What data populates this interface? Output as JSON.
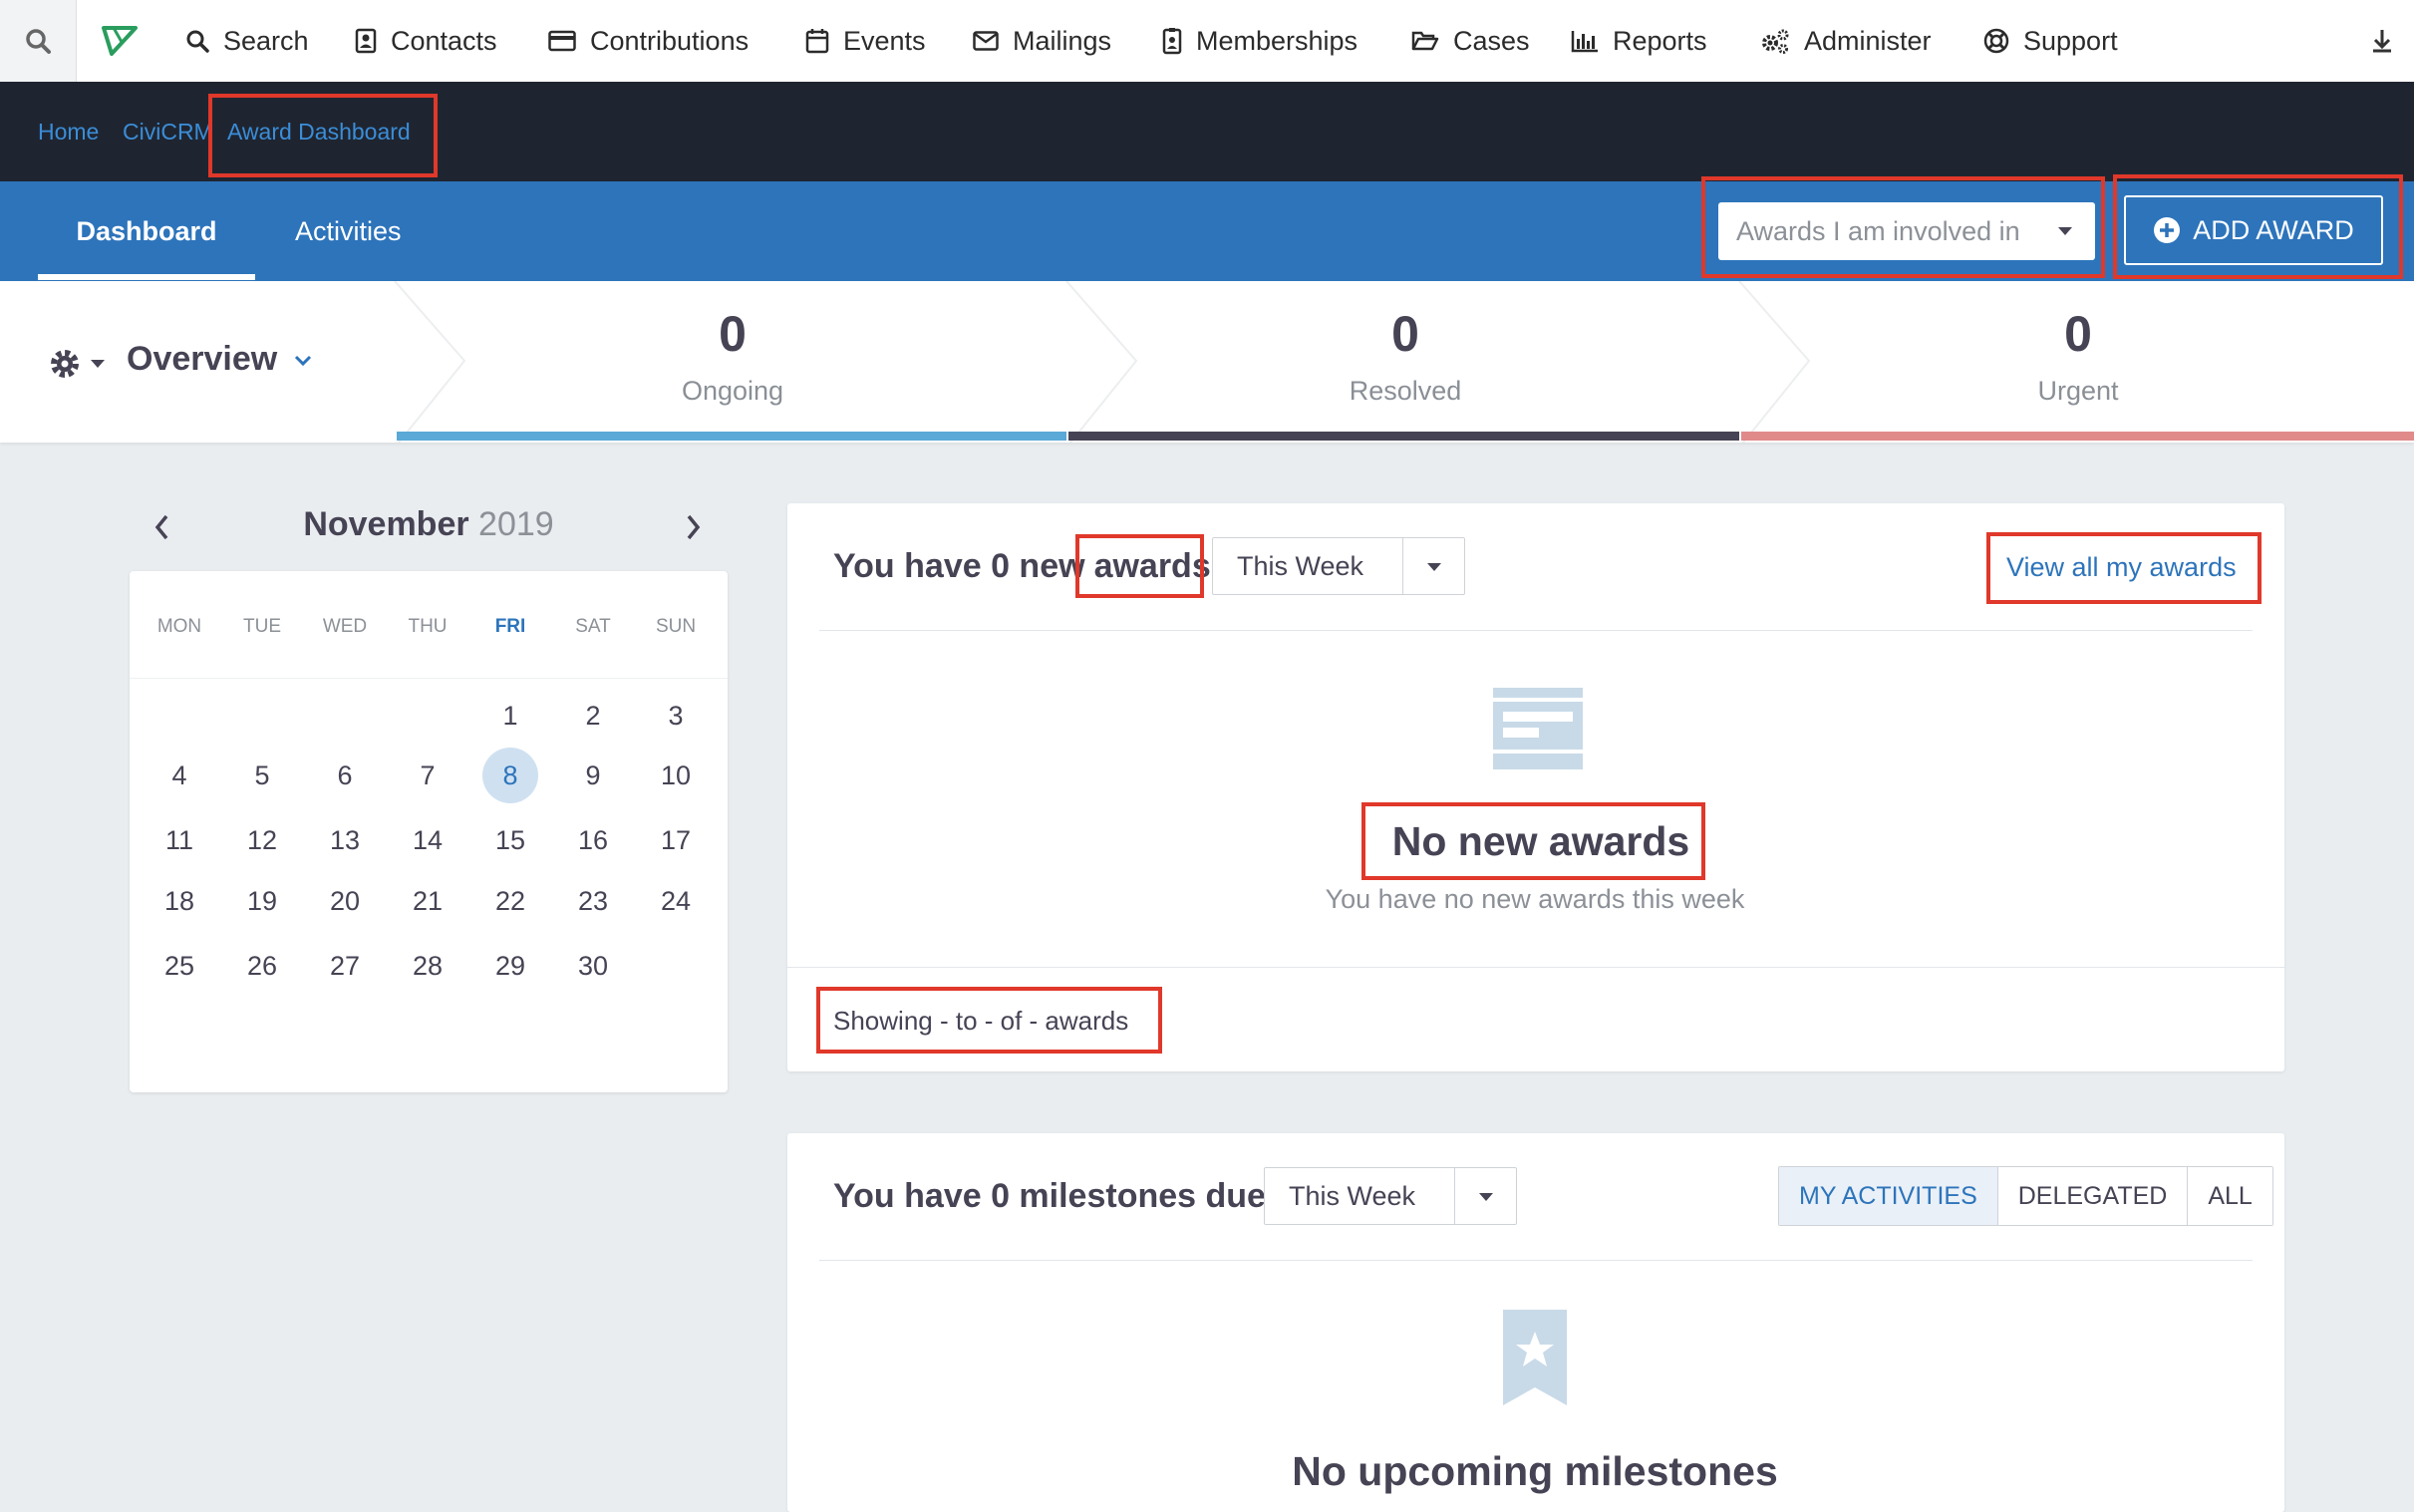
{
  "menu": {
    "items": [
      {
        "label": "Search",
        "icon": "magnifier-icon"
      },
      {
        "label": "Contacts",
        "icon": "contact-card-icon"
      },
      {
        "label": "Contributions",
        "icon": "credit-card-icon"
      },
      {
        "label": "Events",
        "icon": "calendar-icon"
      },
      {
        "label": "Mailings",
        "icon": "envelope-icon"
      },
      {
        "label": "Memberships",
        "icon": "id-badge-icon"
      },
      {
        "label": "Cases",
        "icon": "folder-open-icon"
      },
      {
        "label": "Reports",
        "icon": "bar-chart-icon"
      },
      {
        "label": "Administer",
        "icon": "gears-icon"
      },
      {
        "label": "Support",
        "icon": "life-ring-icon"
      }
    ]
  },
  "breadcrumb": [
    "Home",
    "CiviCRM",
    "Award Dashboard"
  ],
  "tabs": {
    "dashboard": "Dashboard",
    "activities": "Activities"
  },
  "awards_filter": {
    "value": "Awards I am involved in"
  },
  "add_award": {
    "label": "ADD AWARD"
  },
  "overview": {
    "title": "Overview",
    "stats": [
      {
        "value": "0",
        "label": "Ongoing",
        "color": "#5aa9d6"
      },
      {
        "value": "0",
        "label": "Resolved",
        "color": "#464354"
      },
      {
        "value": "0",
        "label": "Urgent",
        "color": "#e08a8a"
      }
    ]
  },
  "calendar": {
    "month": "November",
    "year": "2019",
    "weekdays": [
      "MON",
      "TUE",
      "WED",
      "THU",
      "FRI",
      "SAT",
      "SUN"
    ],
    "highlight_weekday": "FRI",
    "weeks": [
      [
        "",
        "",
        "",
        "",
        "1",
        "2",
        "3"
      ],
      [
        "4",
        "5",
        "6",
        "7",
        "8",
        "9",
        "10"
      ],
      [
        "11",
        "12",
        "13",
        "14",
        "15",
        "16",
        "17"
      ],
      [
        "18",
        "19",
        "20",
        "21",
        "22",
        "23",
        "24"
      ],
      [
        "25",
        "26",
        "27",
        "28",
        "29",
        "30",
        ""
      ]
    ],
    "today": "8"
  },
  "awards_panel": {
    "heading_prefix": "You have 0 new",
    "heading_word": "awards",
    "period": "This Week",
    "view_all": "View all my awards",
    "empty_title": "No new awards",
    "empty_subtitle": "You have no new awards this week",
    "pager": "Showing - to - of - awards"
  },
  "milestones_panel": {
    "heading": "You have 0 milestones due",
    "period": "This Week",
    "filters": [
      "MY ACTIVITIES",
      "DELEGATED",
      "ALL"
    ],
    "empty_title": "No upcoming milestones"
  },
  "colors": {
    "accent": "#2d74bb",
    "navbar": "#1f2530",
    "highlight": "#e0382a"
  }
}
